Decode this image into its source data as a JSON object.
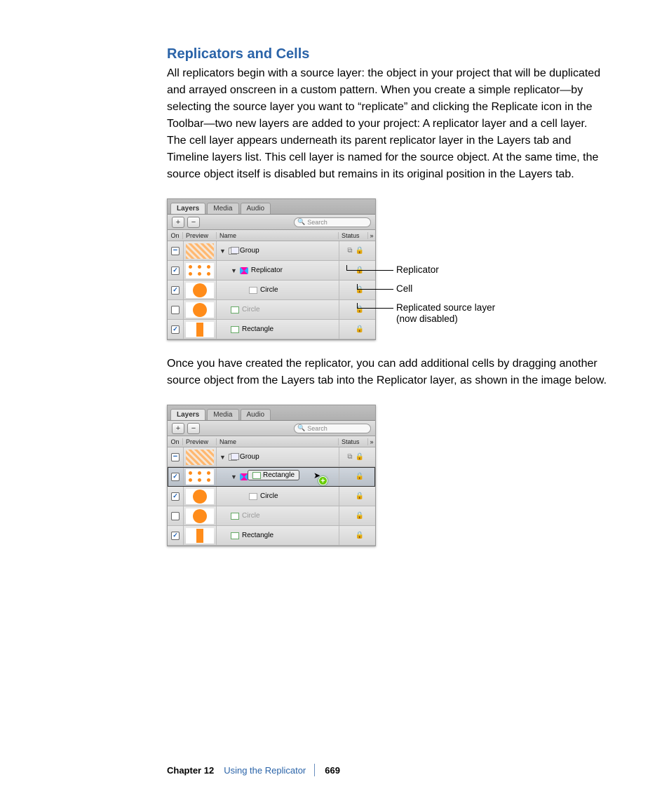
{
  "heading": "Replicators and Cells",
  "para1": "All replicators begin with a source layer: the object in your project that will be duplicated and arrayed onscreen in a custom pattern. When you create a simple replicator—by selecting the source layer you want to “replicate” and clicking the Replicate icon in the Toolbar—two new layers are added to your project: A replicator layer and a cell layer. The cell layer appears underneath its parent replicator layer in the Layers tab and Timeline layers list. This cell layer is named for the source object. At the same time, the source object itself is disabled but remains in its original position in the Layers tab.",
  "para2": "Once you have created the replicator, you can add additional cells by dragging another source object from the Layers tab into the Replicator layer, as shown in the image below.",
  "panel": {
    "tabs": {
      "layers": "Layers",
      "media": "Media",
      "audio": "Audio"
    },
    "plus": "+",
    "minus": "−",
    "search_placeholder": "Search",
    "headers": {
      "on": "On",
      "preview": "Preview",
      "name": "Name",
      "status": "Status",
      "overflow": "»"
    },
    "rows1": [
      {
        "name": "Group",
        "disabled": false
      },
      {
        "name": "Replicator",
        "disabled": false
      },
      {
        "name": "Circle",
        "disabled": false
      },
      {
        "name": "Circle",
        "disabled": true
      },
      {
        "name": "Rectangle",
        "disabled": false
      }
    ],
    "rows2": [
      {
        "name": "Group"
      },
      {
        "name": "Replicator",
        "ghost": "Rectangle"
      },
      {
        "name": "Circle"
      },
      {
        "name": "Circle",
        "disabled": true
      },
      {
        "name": "Rectangle"
      }
    ]
  },
  "callouts": {
    "replicator": "Replicator",
    "cell": "Cell",
    "src1": "Replicated source layer",
    "src2": "(now disabled)"
  },
  "footer": {
    "chapter_label": "Chapter 12",
    "chapter_title": "Using the Replicator",
    "page_number": "669"
  }
}
